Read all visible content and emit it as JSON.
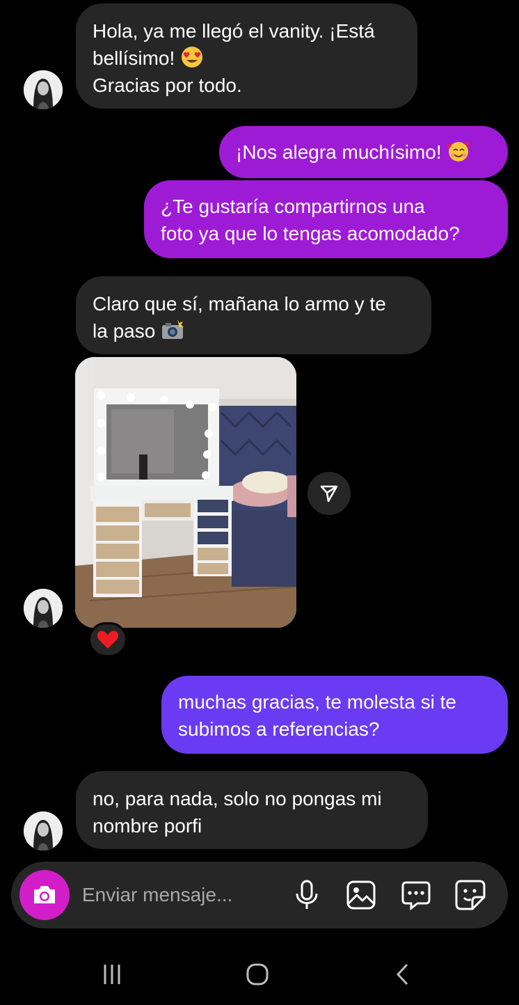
{
  "messages": [
    {
      "sender": "them",
      "lines": [
        "Hola, ya me llegó el vanity. ¡Está",
        "bellísimo!",
        "Gracias por todo."
      ],
      "emoji": "heart-eyes-emoji"
    },
    {
      "sender": "me",
      "lines": [
        "¡Nos alegra muchísimo!"
      ],
      "emoji": "smiling-face-with-hearts-emoji"
    },
    {
      "sender": "me",
      "lines": [
        "¿Te gustaría compartirnos una",
        "foto ya que lo tengas acomodado?"
      ]
    },
    {
      "sender": "them",
      "lines": [
        "Claro que sí, mañana lo armo y te",
        "la paso"
      ],
      "emoji": "camera-with-flash-emoji"
    },
    {
      "sender": "them",
      "type": "photo",
      "reaction": "heart"
    },
    {
      "sender": "me",
      "lines": [
        "muchas gracias, te molesta si te",
        "subimos a referencias?"
      ]
    },
    {
      "sender": "them",
      "lines": [
        "no, para nada, solo no pongas mi",
        "nombre porfi"
      ]
    }
  ],
  "composer": {
    "placeholder": "Enviar mensaje..."
  },
  "colors": {
    "incoming": "#262626",
    "outgoing_purple": "#9e1bd6",
    "outgoing_violet": "#6a3bf2",
    "camera": "#d21ec9"
  }
}
